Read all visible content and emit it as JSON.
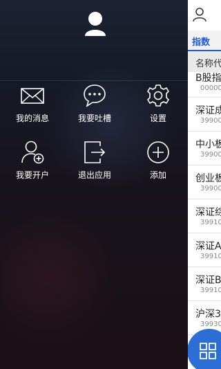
{
  "drawer": {
    "menu": [
      {
        "label": "我的消息",
        "icon": "mail-icon"
      },
      {
        "label": "我要吐槽",
        "icon": "chat-bubble-icon"
      },
      {
        "label": "设置",
        "icon": "gear-icon"
      },
      {
        "label": "我要开户",
        "icon": "add-user-icon"
      },
      {
        "label": "退出应用",
        "icon": "exit-icon"
      },
      {
        "label": "添加",
        "icon": "plus-circle-icon"
      }
    ]
  },
  "background": {
    "tab_label": "指数",
    "column_header": "名称代",
    "rows": [
      {
        "name": "B股指",
        "code": "00000"
      },
      {
        "name": "深证成",
        "code": "39900"
      },
      {
        "name": "中小板",
        "code": "39900"
      },
      {
        "name": "创业板",
        "code": "39900"
      },
      {
        "name": "深证综",
        "code": "39910"
      },
      {
        "name": "深证A",
        "code": "39910"
      },
      {
        "name": "深证B",
        "code": "39910"
      },
      {
        "name": "沪深3",
        "code": "39930"
      }
    ]
  },
  "colors": {
    "accent": "#2b6fd6",
    "tab_accent": "#1e5bd7",
    "drawer_text": "#ffffff"
  }
}
